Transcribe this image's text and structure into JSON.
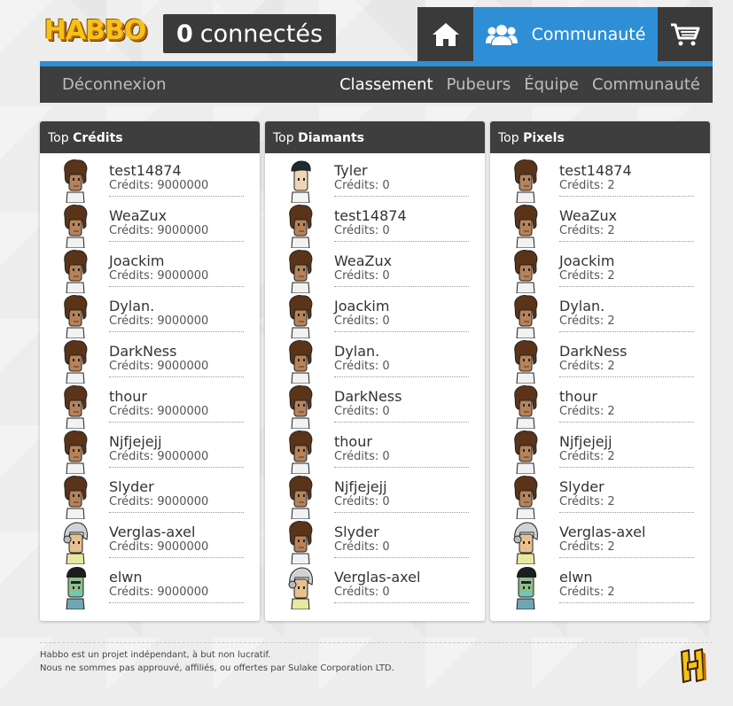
{
  "header": {
    "logo_text": "HABBO",
    "online_count": "0",
    "online_label": "connectés",
    "community_label": "Communauté"
  },
  "subnav": {
    "logout": "Déconnexion",
    "items": [
      "Classement",
      "Pubeurs",
      "Équipe",
      "Communauté"
    ],
    "active": "Classement"
  },
  "panels": [
    {
      "title_prefix": "Top",
      "title_bold": "Crédits",
      "value_label": "Crédits:",
      "rows": [
        {
          "name": "test14874",
          "value": "9000000",
          "avatar": "brown"
        },
        {
          "name": "WeaZux",
          "value": "9000000",
          "avatar": "brown"
        },
        {
          "name": "Joackim",
          "value": "9000000",
          "avatar": "brown"
        },
        {
          "name": "Dylan.",
          "value": "9000000",
          "avatar": "brown"
        },
        {
          "name": "DarkNess",
          "value": "9000000",
          "avatar": "brown"
        },
        {
          "name": "thour",
          "value": "9000000",
          "avatar": "brown"
        },
        {
          "name": "Njfjejejj",
          "value": "9000000",
          "avatar": "brown"
        },
        {
          "name": "Slyder",
          "value": "9000000",
          "avatar": "brown"
        },
        {
          "name": "Verglas-axel",
          "value": "9000000",
          "avatar": "helmet"
        },
        {
          "name": "elwn",
          "value": "9000000",
          "avatar": "green"
        }
      ]
    },
    {
      "title_prefix": "Top",
      "title_bold": "Diamants",
      "value_label": "Crédits:",
      "rows": [
        {
          "name": "Tyler",
          "value": "0",
          "avatar": "default"
        },
        {
          "name": "test14874",
          "value": "0",
          "avatar": "brown"
        },
        {
          "name": "WeaZux",
          "value": "0",
          "avatar": "brown"
        },
        {
          "name": "Joackim",
          "value": "0",
          "avatar": "brown"
        },
        {
          "name": "Dylan.",
          "value": "0",
          "avatar": "brown"
        },
        {
          "name": "DarkNess",
          "value": "0",
          "avatar": "brown"
        },
        {
          "name": "thour",
          "value": "0",
          "avatar": "brown"
        },
        {
          "name": "Njfjejejj",
          "value": "0",
          "avatar": "brown"
        },
        {
          "name": "Slyder",
          "value": "0",
          "avatar": "brown"
        },
        {
          "name": "Verglas-axel",
          "value": "0",
          "avatar": "helmet"
        }
      ]
    },
    {
      "title_prefix": "Top",
      "title_bold": "Pixels",
      "value_label": "Crédits:",
      "rows": [
        {
          "name": "test14874",
          "value": "2",
          "avatar": "brown"
        },
        {
          "name": "WeaZux",
          "value": "2",
          "avatar": "brown"
        },
        {
          "name": "Joackim",
          "value": "2",
          "avatar": "brown"
        },
        {
          "name": "Dylan.",
          "value": "2",
          "avatar": "brown"
        },
        {
          "name": "DarkNess",
          "value": "2",
          "avatar": "brown"
        },
        {
          "name": "thour",
          "value": "2",
          "avatar": "brown"
        },
        {
          "name": "Njfjejejj",
          "value": "2",
          "avatar": "brown"
        },
        {
          "name": "Slyder",
          "value": "2",
          "avatar": "brown"
        },
        {
          "name": "Verglas-axel",
          "value": "2",
          "avatar": "helmet"
        },
        {
          "name": "elwn",
          "value": "2",
          "avatar": "green"
        }
      ]
    }
  ],
  "footer": {
    "line1": "Habbo est un projet indépendant, à but non lucratif.",
    "line2": "Nous ne sommes pas approuvé, affiliés, ou offertes par Sulake Corporation LTD.",
    "logo_text": "H"
  },
  "colors": {
    "accent": "#2e8fd6",
    "dark": "#3e3e3e",
    "logo_yellow": "#f6c21a"
  },
  "icons": [
    "home-icon",
    "users-icon",
    "cart-icon",
    "avatar-icon"
  ]
}
